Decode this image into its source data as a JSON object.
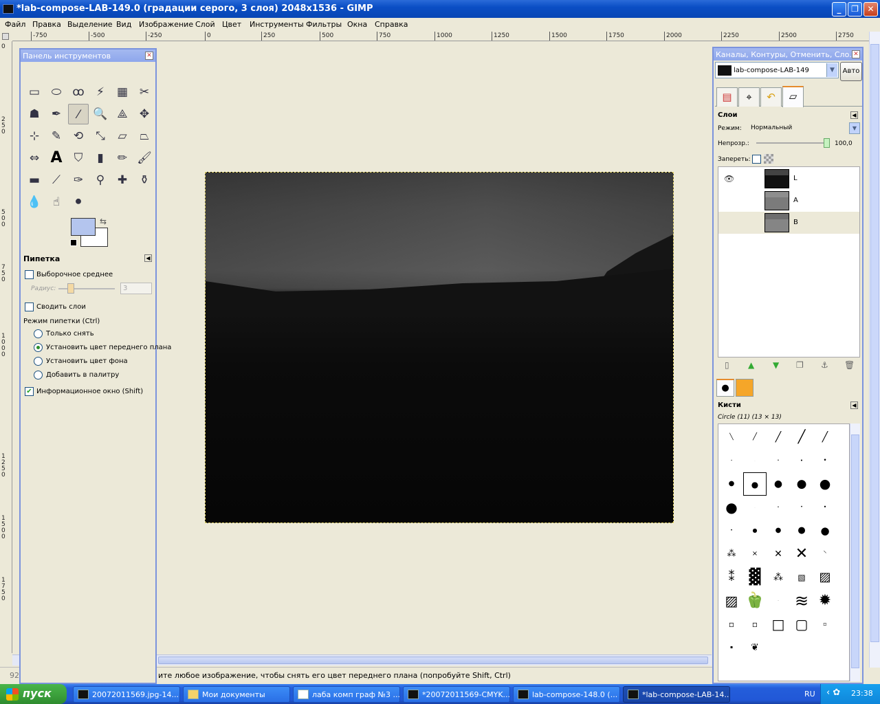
{
  "window": {
    "title": "*lab-compose-LAB-149.0 (градации серого, 3 слоя) 2048x1536 - GIMP"
  },
  "menu": {
    "items": [
      "Файл",
      "Правка",
      "Выделение",
      "Вид",
      "Изображение",
      "Слой",
      "Цвет",
      "Инструменты",
      "Фильтры",
      "Окна",
      "Справка"
    ]
  },
  "ruler": {
    "h_labels": [
      "-750",
      "-500",
      "-250",
      "0",
      "250",
      "500",
      "750",
      "1000",
      "1250",
      "1500",
      "1750",
      "2000",
      "2250",
      "2500",
      "2750"
    ],
    "v_labels": [
      "0",
      "250",
      "500",
      "750",
      "1000",
      "1250",
      "1500",
      "1750"
    ]
  },
  "toolbox": {
    "title": "Панель инструментов",
    "tools": [
      "rect-select-icon",
      "ellipse-select-icon",
      "free-select-icon",
      "fuzzy-select-icon",
      "color-select-icon",
      "scissors-icon",
      "foreground-select-icon",
      "paths-icon",
      "color-picker-icon",
      "zoom-icon",
      "measure-icon",
      "move-icon",
      "align-icon",
      "crop-icon",
      "rotate-icon",
      "scale-icon",
      "shear-icon",
      "perspective-icon",
      "flip-icon",
      "text-icon",
      "bucket-fill-icon",
      "blend-icon",
      "pencil-icon",
      "paintbrush-icon",
      "eraser-icon",
      "airbrush-icon",
      "ink-icon",
      "clone-icon",
      "heal-icon",
      "perspective-clone-icon",
      "blur-icon",
      "smudge-icon",
      "dodge-burn-icon"
    ],
    "tool_options": {
      "header": "Пипетка",
      "sample_average": "Выборочное среднее",
      "radius_label": "Радиус:",
      "radius_value": "3",
      "sample_merged": "Сводить слои",
      "pick_mode_label": "Режим пипетки (Ctrl)",
      "modes": [
        "Только снять",
        "Установить цвет переднего плана",
        "Установить цвет фона",
        "Добавить в палитру"
      ],
      "selected_mode": 1,
      "info_window": "Информационное окно (Shift)",
      "info_window_checked": true
    }
  },
  "status": {
    "zoom": "92",
    "message": "ите любое изображение, чтобы снять его цвет переднего плана (попробуйте Shift, Ctrl)"
  },
  "dock": {
    "title": "Каналы, Контуры, Отменить, Сло...",
    "image_name": "lab-compose-LAB-149",
    "auto_label": "Авто",
    "layers": {
      "header": "Слои",
      "mode_label": "Режим:",
      "mode_value": "Нормальный",
      "opacity_label": "Непрозр.:",
      "opacity_value": "100,0",
      "lock_label": "Запереть:",
      "rows": [
        {
          "name": "L",
          "visible": true,
          "thumb_color": "#181818"
        },
        {
          "name": "A",
          "visible": false,
          "thumb_color": "#8a8a8a"
        },
        {
          "name": "B",
          "visible": false,
          "thumb_color": "#7a7a7a"
        }
      ]
    },
    "brushes": {
      "header": "Кисти",
      "selected": "Circle (11) (13 × 13)"
    }
  },
  "taskbar": {
    "start": "пуск",
    "tasks": [
      "20072011569.jpg-14...",
      "Мои документы",
      "лаба комп граф №3 ...",
      "*20072011569-CMYK...",
      "lab-compose-148.0 (...",
      "*lab-compose-LAB-14..."
    ],
    "lang": "RU",
    "clock": "23:38"
  },
  "colors": {
    "foreground": "#b4c5ee",
    "background": "#ffffff",
    "accent": "#7b93dd"
  }
}
